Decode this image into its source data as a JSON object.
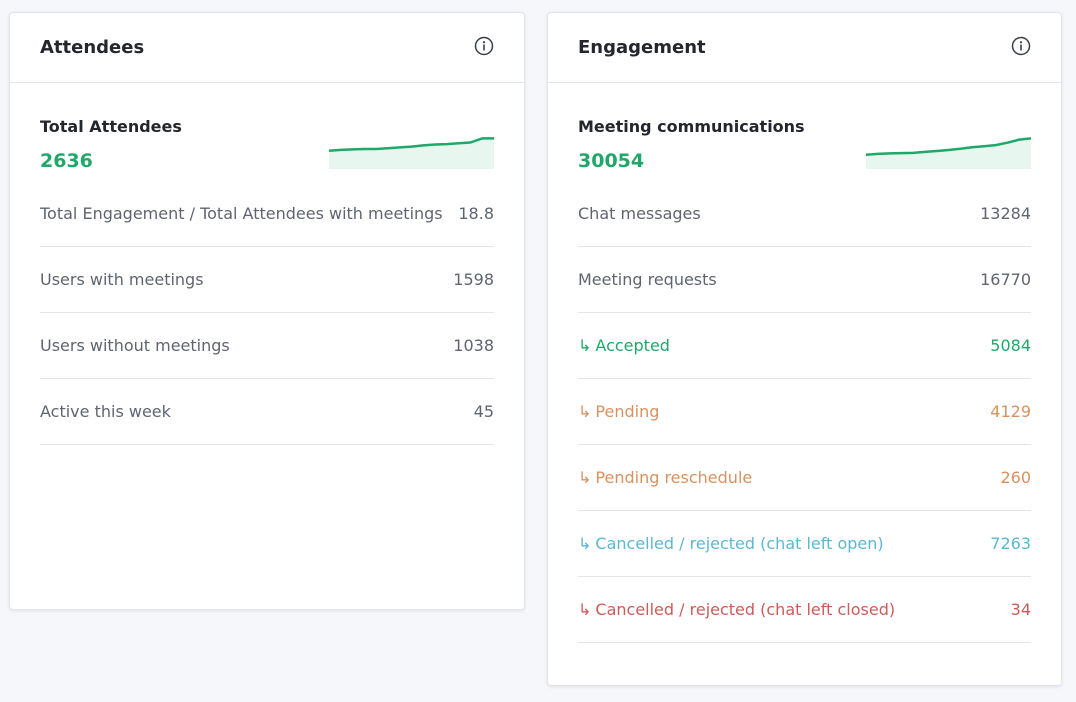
{
  "attendees": {
    "title": "Attendees",
    "summary": {
      "label": "Total Attendees",
      "value": "2636",
      "sparkline": [
        10,
        10.5,
        10.8,
        11,
        11,
        11.5,
        12,
        12.5,
        13.2,
        13.8,
        14,
        14.5,
        15,
        17.5,
        17.5
      ]
    },
    "rows": [
      {
        "label": "Total Engagement / Total Attendees with meetings",
        "value": "18.8"
      },
      {
        "label": "Users with meetings",
        "value": "1598"
      },
      {
        "label": "Users without meetings",
        "value": "1038"
      },
      {
        "label": "Active this week",
        "value": "45"
      }
    ]
  },
  "engagement": {
    "title": "Engagement",
    "summary": {
      "label": "Meeting communications",
      "value": "30054",
      "sparkline": [
        10,
        10.8,
        11.2,
        11.4,
        11.6,
        12.4,
        13.2,
        14,
        15,
        16.2,
        17,
        18,
        20,
        22.5,
        23.5
      ]
    },
    "rows": [
      {
        "label": "Chat messages",
        "value": "13284",
        "tone": "",
        "sub": false
      },
      {
        "label": "Meeting requests",
        "value": "16770",
        "tone": "",
        "sub": false
      },
      {
        "label": "Accepted",
        "value": "5084",
        "tone": "green",
        "sub": true
      },
      {
        "label": "Pending",
        "value": "4129",
        "tone": "orange",
        "sub": true
      },
      {
        "label": "Pending reschedule",
        "value": "260",
        "tone": "orange",
        "sub": true
      },
      {
        "label": "Cancelled / rejected (chat left open)",
        "value": "7263",
        "tone": "cyan",
        "sub": true
      },
      {
        "label": "Cancelled / rejected (chat left closed)",
        "value": "34",
        "tone": "red",
        "sub": true
      }
    ]
  },
  "sub_arrow": "↳",
  "icons": {
    "info": "info-circle-icon"
  },
  "colors": {
    "accent_green": "#1fa86a",
    "orange": "#d9915e",
    "cyan": "#5bb8d2",
    "red": "#d05a5a"
  }
}
